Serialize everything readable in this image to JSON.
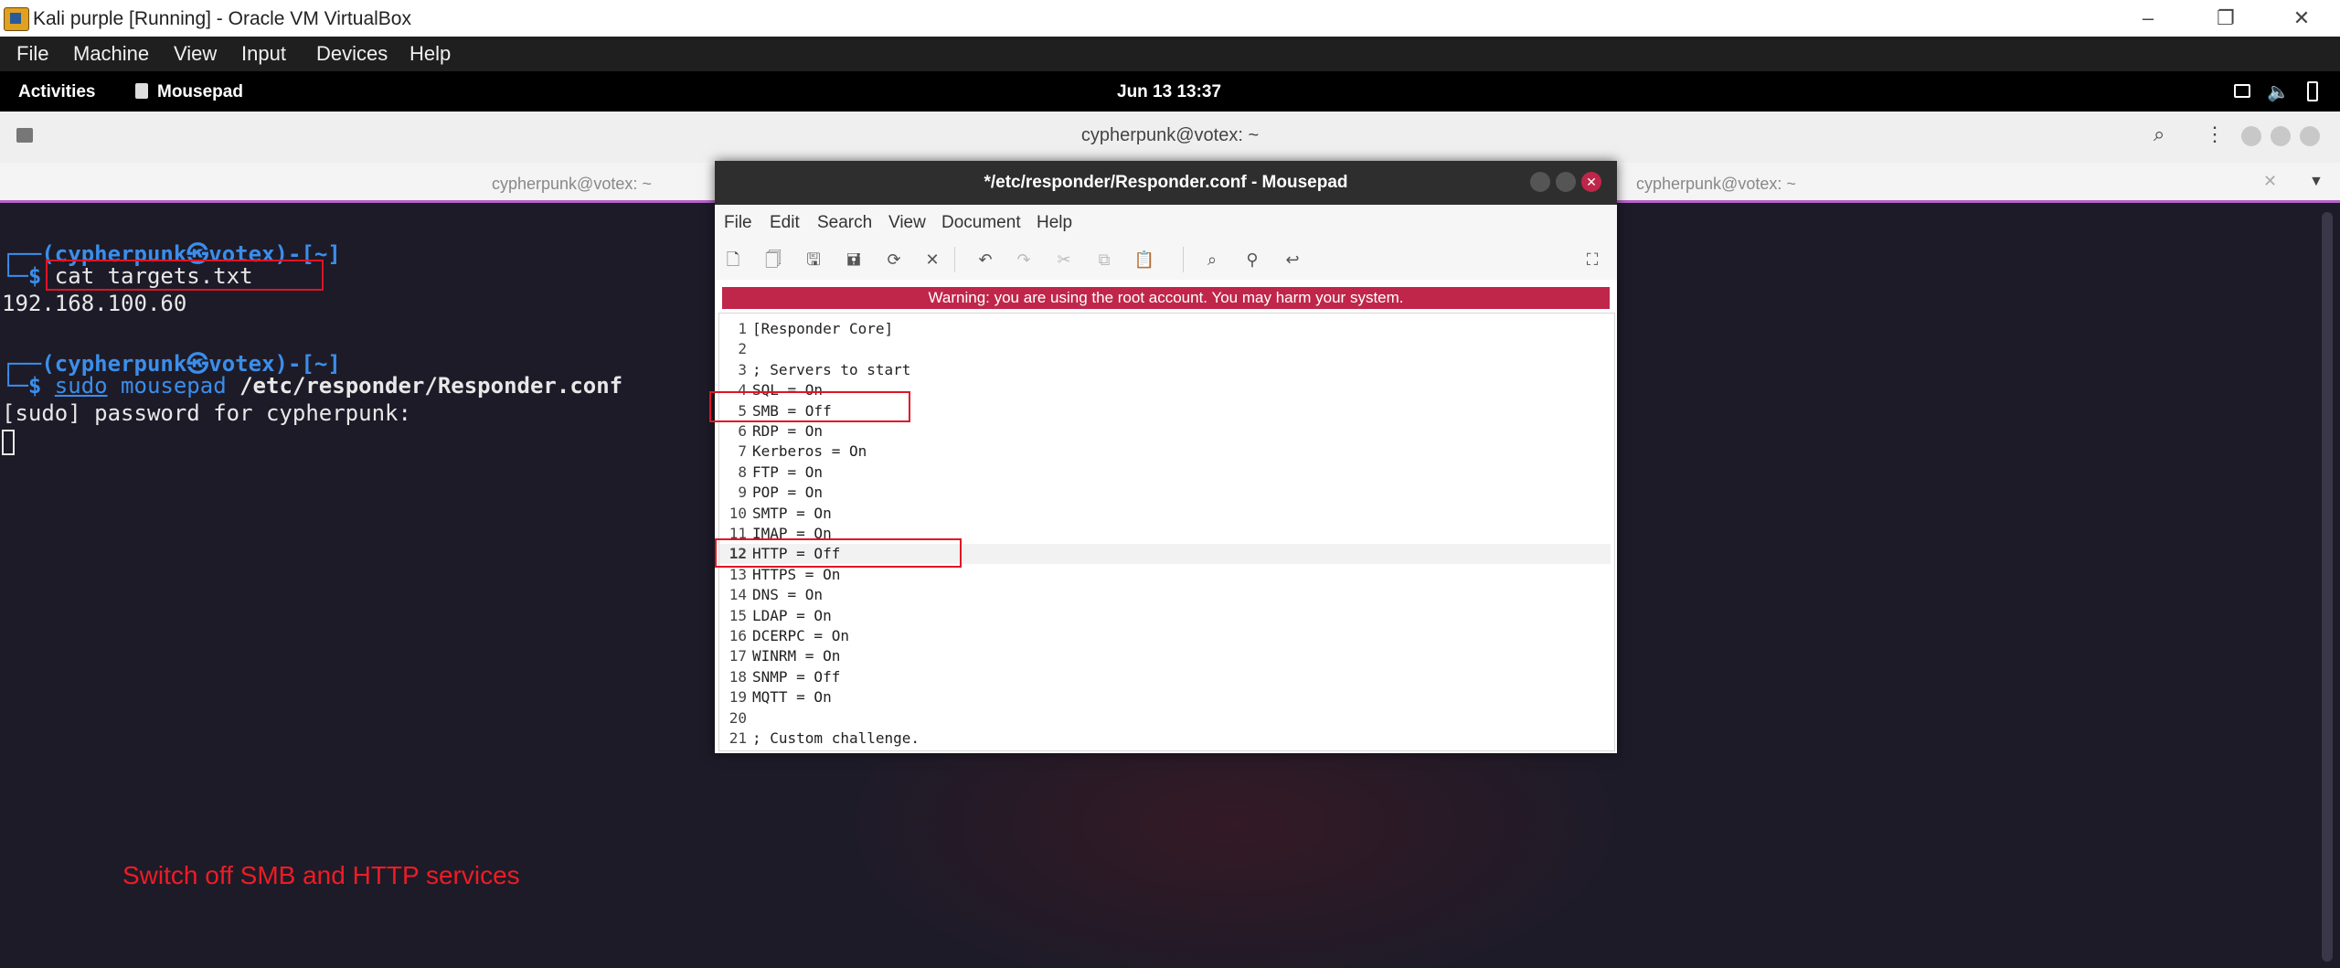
{
  "host_window": {
    "title": "Kali purple [Running] - Oracle VM VirtualBox",
    "menu": [
      "File",
      "Machine",
      "View",
      "Input",
      "Devices",
      "Help"
    ]
  },
  "gnome_bar": {
    "activities": "Activities",
    "app": "Mousepad",
    "datetime": "Jun 13  13:37"
  },
  "terminal": {
    "title": "cypherpunk@votex: ~",
    "tab_left": "cypherpunk@votex: ~",
    "tab_right": "cypherpunk@votex: ~",
    "prompt1": "┌──(cypherpunk㉿votex)-[~]",
    "cmd1_prefix": "└─$ ",
    "cmd1": "cat targets.txt",
    "output1": "192.168.100.60",
    "prompt2": "┌──(cypherpunk㉿votex)-[~]",
    "cmd2_prefix": "└─$ ",
    "cmd2_sudo": "sudo",
    "cmd2_mousepad": "mousepad",
    "cmd2_arg": "/etc/responder/Responder.conf",
    "output2": "[sudo] password for cypherpunk:"
  },
  "annotation": "Switch off SMB and HTTP services",
  "mousepad": {
    "title": "*/etc/responder/Responder.conf - Mousepad",
    "menu": [
      "File",
      "Edit",
      "Search",
      "View",
      "Document",
      "Help"
    ],
    "warning": "Warning: you are using the root account. You may harm your system.",
    "lines": [
      "[Responder Core]",
      "",
      "; Servers to start",
      "SQL = On",
      "SMB = Off",
      "RDP = On",
      "Kerberos = On",
      "FTP = On",
      "POP = On",
      "SMTP = On",
      "IMAP = On",
      "HTTP = Off",
      "HTTPS = On",
      "DNS = On",
      "LDAP = On",
      "DCERPC = On",
      "WINRM = On",
      "SNMP = Off",
      "MQTT = On",
      "",
      "; Custom challenge."
    ],
    "current_line": 12
  },
  "colors": {
    "prompt_blue": "#3b8eea",
    "annotation_red": "#ee1c25",
    "warning_bg": "#c0264a",
    "terminal_bg": "#1d1b28"
  }
}
